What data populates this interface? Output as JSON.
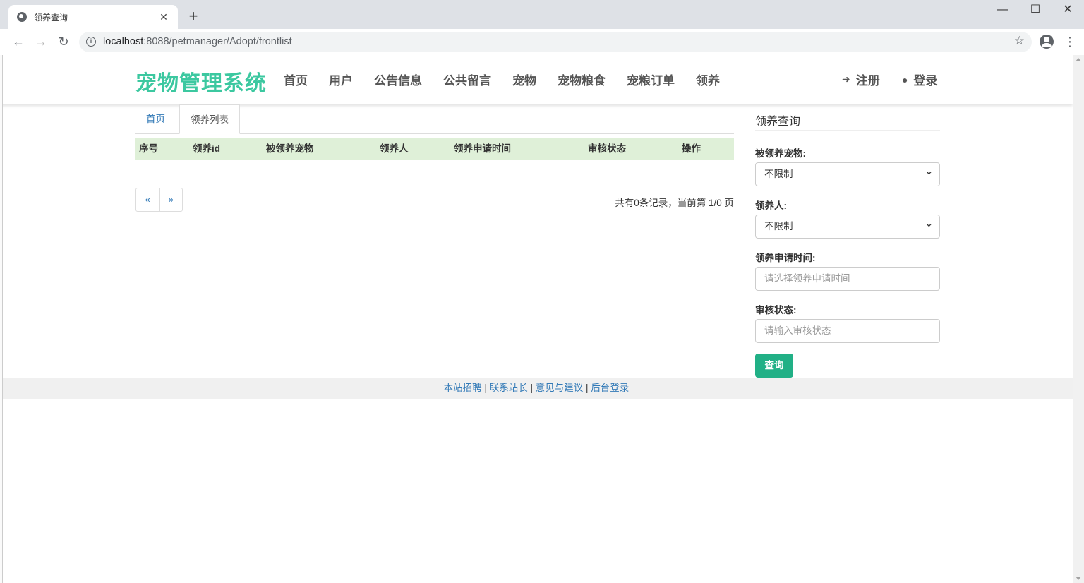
{
  "browser": {
    "tab_title": "领养查询",
    "tab_close": "✕",
    "new_tab": "+",
    "url_host": "localhost",
    "url_rest": ":8088/petmanager/Adopt/frontlist",
    "win_min": "—",
    "win_max": "☐",
    "win_close": "✕"
  },
  "header": {
    "brand": "宠物管理系统",
    "nav": [
      "首页",
      "用户",
      "公告信息",
      "公共留言",
      "宠物",
      "宠物粮食",
      "宠粮订单",
      "领养"
    ],
    "register": "注册",
    "login": "登录"
  },
  "content": {
    "tabs": [
      "首页",
      "领养列表"
    ],
    "columns": [
      "序号",
      "领养id",
      "被领养宠物",
      "领养人",
      "领养申请时间",
      "审核状态",
      "操作"
    ],
    "pager_prev": "«",
    "pager_next": "»",
    "record_info": "共有0条记录，当前第 1/0 页"
  },
  "sidebar": {
    "title": "领养查询",
    "pet_label": "被领养宠物:",
    "pet_value": "不限制",
    "adopter_label": "领养人:",
    "adopter_value": "不限制",
    "time_label": "领养申请时间:",
    "time_placeholder": "请选择领养申请时间",
    "status_label": "审核状态:",
    "status_placeholder": "请输入审核状态",
    "query_button": "查询"
  },
  "footer": {
    "links": [
      "本站招聘",
      "联系站长",
      "意见与建议",
      "后台登录"
    ],
    "separator": "|"
  },
  "colors": {
    "brand": "#3cc8a0",
    "query_button": "#21b086",
    "table_header": "#dff0d8",
    "link": "#337ab7"
  },
  "icons": {
    "register": "sign-in-icon",
    "login": "user-icon"
  }
}
